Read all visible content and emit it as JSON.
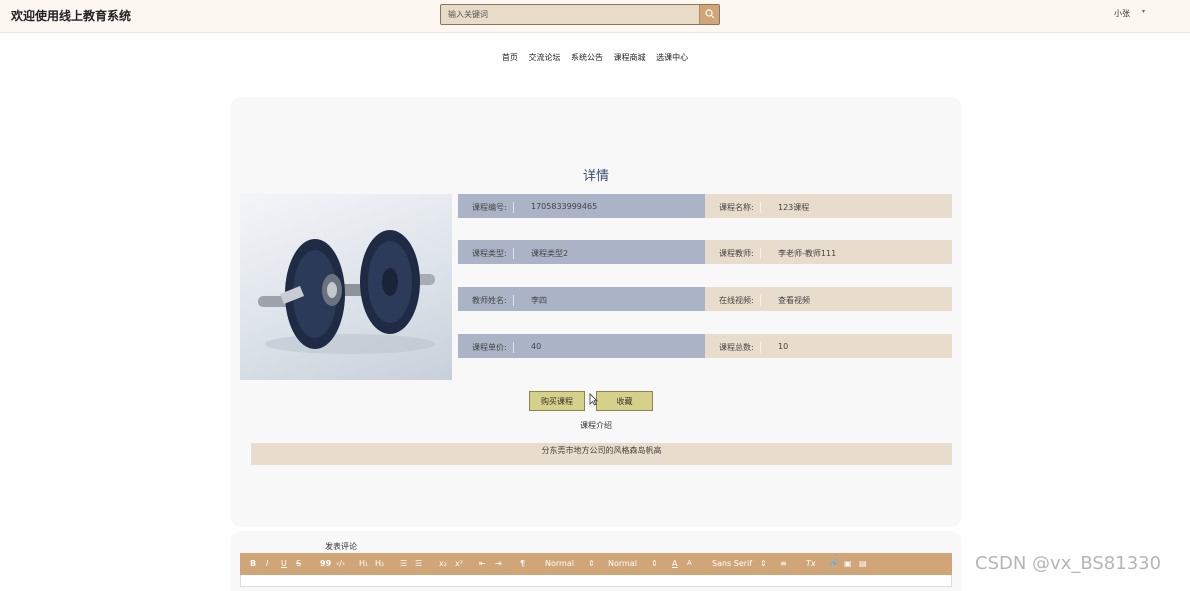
{
  "header": {
    "site_title": "欢迎使用线上教育系统",
    "search_placeholder": "输入关键词",
    "user_name": "小张",
    "user_caret": "▾"
  },
  "nav": {
    "items": [
      "首页",
      "交流论坛",
      "系统公告",
      "课程商城",
      "选课中心"
    ]
  },
  "detail": {
    "title": "详情",
    "fields": [
      {
        "label": "课程编号:",
        "value": "1705833999465"
      },
      {
        "label": "课程名称:",
        "value": "123课程"
      },
      {
        "label": "课程类型:",
        "value": "课程类型2"
      },
      {
        "label": "课程教师:",
        "value": "李老师-教师111"
      },
      {
        "label": "教师姓名:",
        "value": "李四"
      },
      {
        "label": "在线视频:",
        "value": "查看视频"
      },
      {
        "label": "课程单价:",
        "value": "40"
      },
      {
        "label": "课程总数:",
        "value": "10"
      }
    ],
    "buy_label": "购买课程",
    "fav_label": "收藏",
    "intro_title": "课程介绍",
    "intro_text": "分东莞市地方公司的风格森岛帆高"
  },
  "comment": {
    "label": "发表评论",
    "toolbar": {
      "bold": "B",
      "italic": "I",
      "underline": "U",
      "strike": "S",
      "quote": "99",
      "code": "‹/›",
      "h1": "H₁",
      "h2": "H₂",
      "ordered": "☰",
      "bullet": "☰",
      "sub": "x₂",
      "sup": "x²",
      "outdent": "⇤",
      "indent": "⇥",
      "rtl": "¶",
      "size": "Normal",
      "header": "Normal",
      "color": "A",
      "bg": "A",
      "font": "Sans Serif",
      "align": "≡",
      "clean": "Tx",
      "link": "🔗",
      "image": "▣",
      "video": "▤"
    }
  },
  "watermark": "CSDN @vx_BS81330",
  "colors": {
    "header_bg": "#fdf7f2",
    "accent": "#d0a679",
    "left_cell": "#aab4c6",
    "right_cell": "#e8dccc",
    "button": "#d5d08a"
  }
}
